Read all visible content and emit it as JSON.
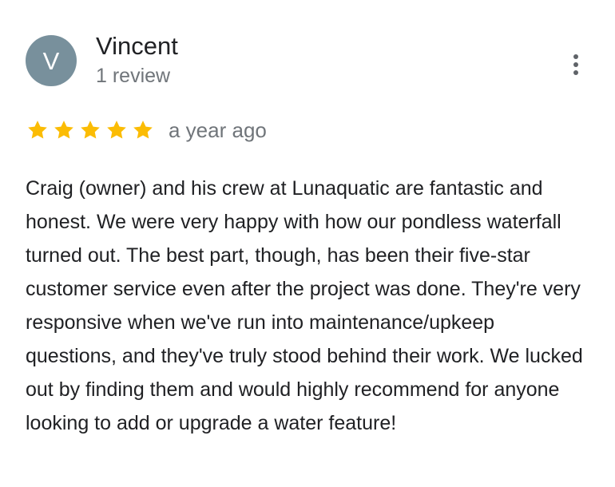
{
  "reviewer": {
    "avatar_initial": "V",
    "name": "Vincent",
    "review_count": "1 review"
  },
  "review": {
    "rating": 5,
    "max_rating": 5,
    "timestamp": "a year ago",
    "text": "Craig (owner) and his crew at Lunaquatic are fantastic and honest. We were very happy with how our pondless waterfall turned out. The best part, though, has been their five-star customer service even after the project was done. They're very responsive when we've run into maintenance/upkeep questions, and they've truly stood behind their work. We lucked out by finding them and would highly recommend for anyone looking to add or upgrade a water feature!"
  },
  "icons": {
    "menu": "more-vert-icon",
    "rating": "star-icon"
  },
  "colors": {
    "avatar_background": "#78909c",
    "star": "#fbbc04",
    "primary_text": "#202124",
    "secondary_text": "#70757a",
    "menu_icon": "#5f6368"
  }
}
